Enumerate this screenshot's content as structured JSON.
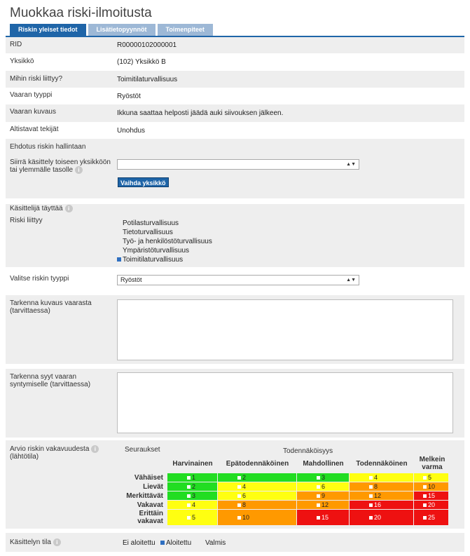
{
  "page_title": "Muokkaa riski-ilmoitusta",
  "tabs": [
    "Riskin yleiset tiedot",
    "Lisätietopyynnöt",
    "Toimenpiteet"
  ],
  "fields": {
    "rid": {
      "label": "RID",
      "value": "R00000102000001"
    },
    "yksikko": {
      "label": "Yksikkö",
      "value": "(102) Yksikkö B"
    },
    "mihin": {
      "label": "Mihin riski liittyy?",
      "value": "Toimitilaturvallisuus"
    },
    "vaaran_tyyppi": {
      "label": "Vaaran tyyppi",
      "value": "Ryöstöt"
    },
    "vaaran_kuvaus": {
      "label": "Vaaran kuvaus",
      "value": "Ikkuna saattaa helposti jäädä auki siivouksen jälkeen."
    },
    "altistavat": {
      "label": "Altistavat tekijät",
      "value": "Unohdus"
    },
    "ehdotus": {
      "label": "Ehdotus riskin hallintaan",
      "value": ""
    }
  },
  "siirra": {
    "label_1": "Siirrä käsittely toiseen yksikköön",
    "label_2": "tai ylemmälle tasolle",
    "select_value": "",
    "button": "Vaihda yksikkö"
  },
  "kasittelija": {
    "label": "Käsittelijä täyttää"
  },
  "riski_liittyy": {
    "label": "Riski liittyy",
    "options": [
      {
        "label": "Potilasturvallisuus",
        "checked": false
      },
      {
        "label": "Tietoturvallisuus",
        "checked": false
      },
      {
        "label": "Työ- ja henkilöstöturvallisuus",
        "checked": false
      },
      {
        "label": "Ympäristöturvallisuus",
        "checked": false
      },
      {
        "label": "Toimitilaturvallisuus",
        "checked": true
      }
    ]
  },
  "valitse_tyyppi": {
    "label": "Valitse riskin tyyppi",
    "value": "Ryöstöt"
  },
  "tarkenna_kuvaus": {
    "label_1": "Tarkenna kuvaus vaarasta",
    "label_2": "(tarvittaessa)",
    "value": ""
  },
  "tarkenna_syyt": {
    "label_1": "Tarkenna syyt vaaran",
    "label_2": "syntymiselle (tarvittaessa)",
    "value": ""
  },
  "arvio": {
    "label_1": "Arvio riskin vakavuudesta",
    "label_2": "(lähtötila)",
    "seuraukset": "Seuraukset",
    "todennakoisyys": "Todennäköisyys",
    "columns": [
      "Harvinainen",
      "Epätodennäköinen",
      "Mahdollinen",
      "Todennäköinen",
      "Melkein varma"
    ],
    "rows": [
      {
        "label": "Vähäiset",
        "values": [
          "1",
          "2",
          "3",
          "4",
          "5"
        ]
      },
      {
        "label": "Lievät",
        "values": [
          "2",
          "4",
          "6",
          "8",
          "10"
        ]
      },
      {
        "label": "Merkittävät",
        "values": [
          "3",
          "6",
          "9",
          "12",
          "15"
        ]
      },
      {
        "label": "Vakavat",
        "values": [
          "4",
          "8",
          "12",
          "16",
          "20"
        ]
      },
      {
        "label": "Erittäin vakavat",
        "values": [
          "5",
          "10",
          "15",
          "20",
          "25"
        ]
      }
    ],
    "colors": {
      "green": "#22dd22",
      "yellow": "#ffff11",
      "orange": "#ff9900",
      "red": "#ee1111"
    }
  },
  "kasittelyn_tila": {
    "label": "Käsittelyn tila",
    "options": [
      {
        "label": "Ei aloitettu",
        "checked": false
      },
      {
        "label": "Aloitettu",
        "checked": true
      },
      {
        "label": "Valmis",
        "checked": false
      }
    ]
  },
  "colors": {
    "accent": "#1f65a8",
    "tab_inactive": "#9db8d6",
    "row_bg": "#eeeeee"
  }
}
